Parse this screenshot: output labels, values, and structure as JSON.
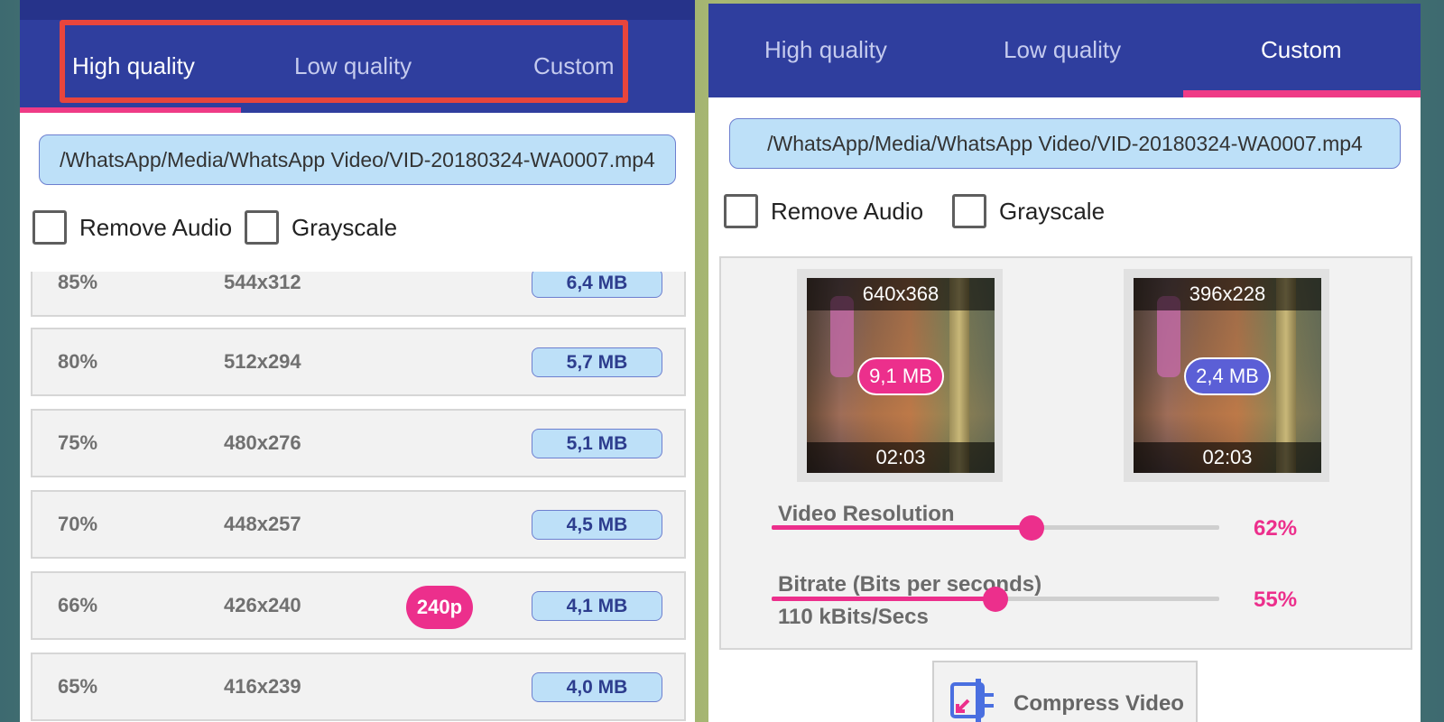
{
  "left_panel": {
    "tabs": [
      "High quality",
      "Low quality",
      "Custom"
    ],
    "active_tab": "High quality",
    "file_path": "/WhatsApp/Media/WhatsApp Video/VID-20180324-WA0007.mp4",
    "options": {
      "remove_audio": "Remove Audio",
      "grayscale": "Grayscale"
    },
    "rows": [
      {
        "percent": "85%",
        "resolution": "544x312",
        "size": "6,4 MB"
      },
      {
        "percent": "80%",
        "resolution": "512x294",
        "size": "5,7 MB"
      },
      {
        "percent": "75%",
        "resolution": "480x276",
        "size": "5,1 MB"
      },
      {
        "percent": "70%",
        "resolution": "448x257",
        "size": "4,5 MB"
      },
      {
        "percent": "66%",
        "resolution": "426x240",
        "size": "4,1 MB",
        "badge": "240p"
      },
      {
        "percent": "65%",
        "resolution": "416x239",
        "size": "4,0 MB"
      }
    ]
  },
  "right_panel": {
    "tabs": [
      "High quality",
      "Low quality",
      "Custom"
    ],
    "active_tab": "Custom",
    "file_path": "/WhatsApp/Media/WhatsApp Video/VID-20180324-WA0007.mp4",
    "options": {
      "remove_audio": "Remove Audio",
      "grayscale": "Grayscale"
    },
    "original": {
      "resolution": "640x368",
      "size": "9,1 MB",
      "duration": "02:03",
      "size_color": "#ec2f8c"
    },
    "compressed": {
      "resolution": "396x228",
      "size": "2,4 MB",
      "duration": "02:03",
      "size_color": "#5b5fd6"
    },
    "video_resolution": {
      "label": "Video Resolution",
      "value_text": "62%",
      "fraction": 0.58
    },
    "bitrate": {
      "label": "Bitrate (Bits per seconds)",
      "value_text": "55%",
      "sublabel": "110 kBits/Secs",
      "fraction": 0.5
    },
    "compress_button": "Compress Video"
  },
  "colors": {
    "primary": "#2f3e9e",
    "accent": "#ec2f8c",
    "highlight": "#e8453c",
    "field_bg": "#bde0f8"
  }
}
